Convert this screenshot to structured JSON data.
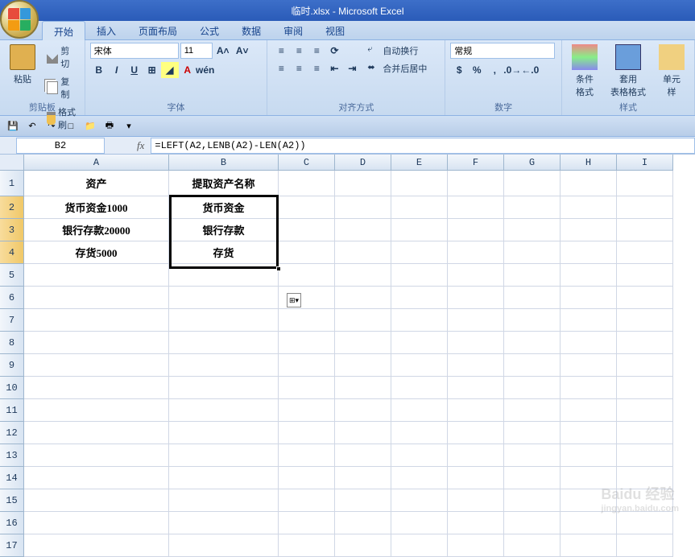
{
  "title": "临时.xlsx - Microsoft Excel",
  "tabs": [
    "开始",
    "插入",
    "页面布局",
    "公式",
    "数据",
    "审阅",
    "视图"
  ],
  "active_tab": 0,
  "ribbon": {
    "clipboard": {
      "label": "剪贴板",
      "cut": "剪切",
      "copy": "复制",
      "paint": "格式刷",
      "paste": "粘贴"
    },
    "font": {
      "label": "字体",
      "name": "宋体",
      "size": "11"
    },
    "alignment": {
      "label": "对齐方式",
      "wrap": "自动换行",
      "merge": "合并后居中"
    },
    "number": {
      "label": "数字",
      "format": "常规"
    },
    "styles": {
      "label": "样式",
      "cond": "条件格式",
      "table": "套用\n表格格式",
      "cell": "单元\n样"
    }
  },
  "namebox": "B2",
  "formula": "=LEFT(A2,LENB(A2)-LEN(A2))",
  "columns": [
    "A",
    "B",
    "C",
    "D",
    "E",
    "F",
    "G",
    "H",
    "I"
  ],
  "rows": [
    "1",
    "2",
    "3",
    "4",
    "5",
    "6",
    "7",
    "8",
    "9",
    "10",
    "11",
    "12",
    "13",
    "14",
    "15",
    "16",
    "17"
  ],
  "data": {
    "A1": "资产",
    "B1": "提取资产名称",
    "A2": "货币资金1000",
    "B2": "货币资金",
    "A3": "银行存款20000",
    "B3": "银行存款",
    "A4": "存货5000",
    "B4": "存货"
  },
  "watermark": "Baidu 经验",
  "watermark_sub": "jingyan.baidu.com"
}
